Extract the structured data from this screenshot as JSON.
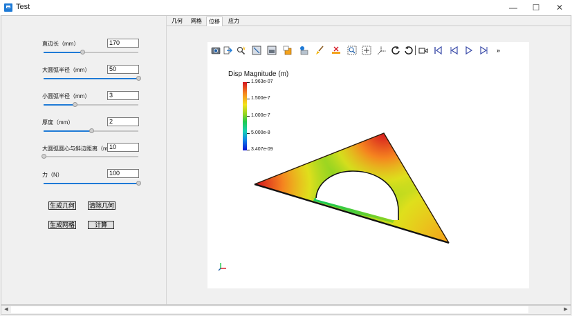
{
  "window": {
    "title": "Test",
    "minimize_glyph": "—",
    "maximize_glyph": "☐",
    "close_glyph": "✕"
  },
  "params": [
    {
      "label": "直边长（mm）",
      "value": "170",
      "slider_fraction": 0.41
    },
    {
      "label": "大圆弧半径（mm）",
      "value": "50",
      "slider_fraction": 1.0
    },
    {
      "label": "小圆弧半径（mm）",
      "value": "3",
      "slider_fraction": 0.33
    },
    {
      "label": "厚度（mm）",
      "value": "2",
      "slider_fraction": 0.5
    },
    {
      "label": "大圆弧圆心与斜边距离（mm",
      "value": "10",
      "slider_fraction": 0.0
    },
    {
      "label": "力（N）",
      "value": "100",
      "slider_fraction": 1.0
    }
  ],
  "buttons": {
    "generate_geometry": "生成几何",
    "clear_geometry": "清除几何",
    "generate_mesh": "生成网格",
    "compute": "计算"
  },
  "tabs": [
    {
      "label": "几何",
      "active": false
    },
    {
      "label": "网格",
      "active": false
    },
    {
      "label": "位移",
      "active": true
    },
    {
      "label": "应力",
      "active": false
    }
  ],
  "toolbar": {
    "icons": [
      "camera-icon",
      "export-icon",
      "pick-icon",
      "view-box-icon",
      "view-box2-icon",
      "orientation-icon",
      "render-mode-icon",
      "paint-brush-icon",
      "measure-icon",
      "zoom-box-icon",
      "zoom-fit-icon",
      "axes-select-icon",
      "rotate-cw-icon",
      "rotate-ccw-icon",
      "video-camera-icon",
      "first-frame-icon",
      "prev-frame-icon",
      "play-icon",
      "next-frame-icon"
    ],
    "more_glyph": "»"
  },
  "legend": {
    "title": "Disp Magnitude (m)",
    "ticks": [
      "1.963e-07",
      "1.500e-7",
      "1.000e-7",
      "5.000e-8",
      "3.407e-09"
    ],
    "colors": {
      "max": "#d4141f",
      "mid": "#8bd322",
      "min": "#0a12d6"
    }
  },
  "scrollbar": {
    "left_glyph": "◀",
    "right_glyph": "▶"
  }
}
